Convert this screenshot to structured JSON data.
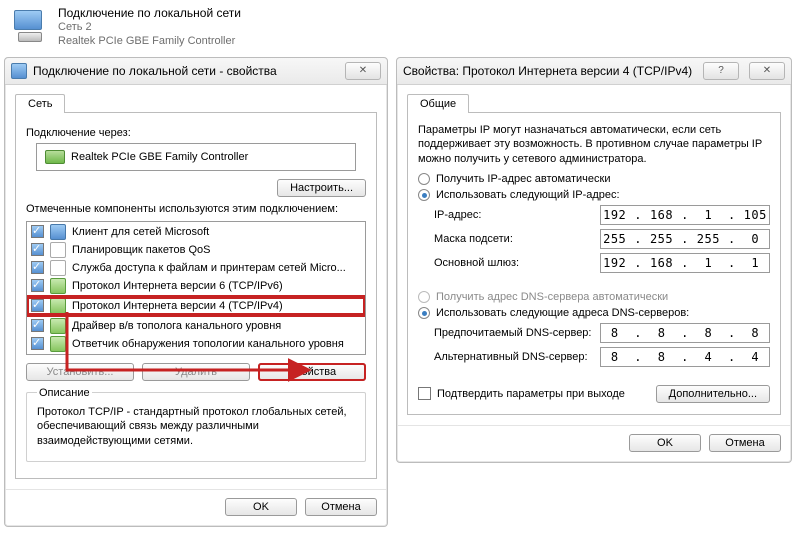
{
  "header": {
    "title": "Подключение по локальной сети",
    "subtitle": "Сеть 2",
    "adapter": "Realtek PCIe GBE Family Controller"
  },
  "dlg1": {
    "title": "Подключение по локальной сети - свойства",
    "tab_net": "Сеть",
    "connect_via_label": "Подключение через:",
    "adapter": "Realtek PCIe GBE Family Controller",
    "configure_btn": "Настроить...",
    "components_label": "Отмеченные компоненты используются этим подключением:",
    "items": [
      "Клиент для сетей Microsoft",
      "Планировщик пакетов QoS",
      "Служба доступа к файлам и принтерам сетей Micro...",
      "Протокол Интернета версии 6 (TCP/IPv6)",
      "Протокол Интернета версии 4 (TCP/IPv4)",
      "Драйвер в/в тополога канального уровня",
      "Ответчик обнаружения топологии канального уровня"
    ],
    "install_btn": "Установить...",
    "remove_btn": "Удалить",
    "props_btn": "Свойства",
    "desc_legend": "Описание",
    "desc_text": "Протокол TCP/IP - стандартный протокол глобальных сетей, обеспечивающий связь между различными взаимодействующими сетями.",
    "ok": "OK",
    "cancel": "Отмена"
  },
  "dlg2": {
    "title": "Свойства: Протокол Интернета версии 4 (TCP/IPv4)",
    "tab_general": "Общие",
    "intro": "Параметры IP могут назначаться автоматически, если сеть поддерживает эту возможность. В противном случае параметры IP можно получить у сетевого администратора.",
    "ip_auto": "Получить IP-адрес автоматически",
    "ip_manual": "Использовать следующий IP-адрес:",
    "ip_label": "IP-адрес:",
    "mask_label": "Маска подсети:",
    "gw_label": "Основной шлюз:",
    "ip_val": [
      "192",
      "168",
      "1",
      "105"
    ],
    "mask_val": [
      "255",
      "255",
      "255",
      "0"
    ],
    "gw_val": [
      "192",
      "168",
      "1",
      "1"
    ],
    "dns_auto": "Получить адрес DNS-сервера автоматически",
    "dns_manual": "Использовать следующие адреса DNS-серверов:",
    "dns1_label": "Предпочитаемый DNS-сервер:",
    "dns2_label": "Альтернативный DNS-сервер:",
    "dns1_val": [
      "8",
      "8",
      "8",
      "8"
    ],
    "dns2_val": [
      "8",
      "8",
      "4",
      "4"
    ],
    "validate_label": "Подтвердить параметры при выходе",
    "advanced_btn": "Дополнительно...",
    "ok": "OK",
    "cancel": "Отмена"
  }
}
